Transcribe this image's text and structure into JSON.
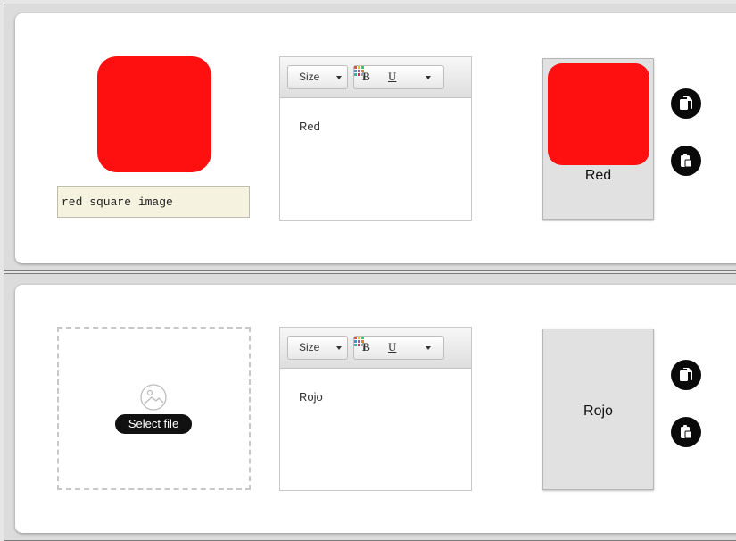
{
  "cards": [
    {
      "image_color": "#ff1010",
      "image_alt_input": "red square image",
      "editor": {
        "size_label": "Size",
        "bold_label": "B",
        "underline_label": "U",
        "content": "Red"
      },
      "preview": {
        "text": "Red",
        "image_color": "#ff1010"
      }
    },
    {
      "select_file_label": "Select file",
      "editor": {
        "size_label": "Size",
        "bold_label": "B",
        "underline_label": "U",
        "content": "Rojo"
      },
      "preview": {
        "text": "Rojo"
      }
    }
  ],
  "icons": {
    "image_placeholder": "image-icon",
    "copy": "copy-icon",
    "paste": "paste-icon",
    "color_picker": "color-grid-icon",
    "dropdown": "caret-down-icon"
  },
  "colors": {
    "accent_red": "#ff1010",
    "caption_bg": "#f5f3e0",
    "preview_bg": "#e1e1e1",
    "button_dark": "#0a0a0a"
  }
}
